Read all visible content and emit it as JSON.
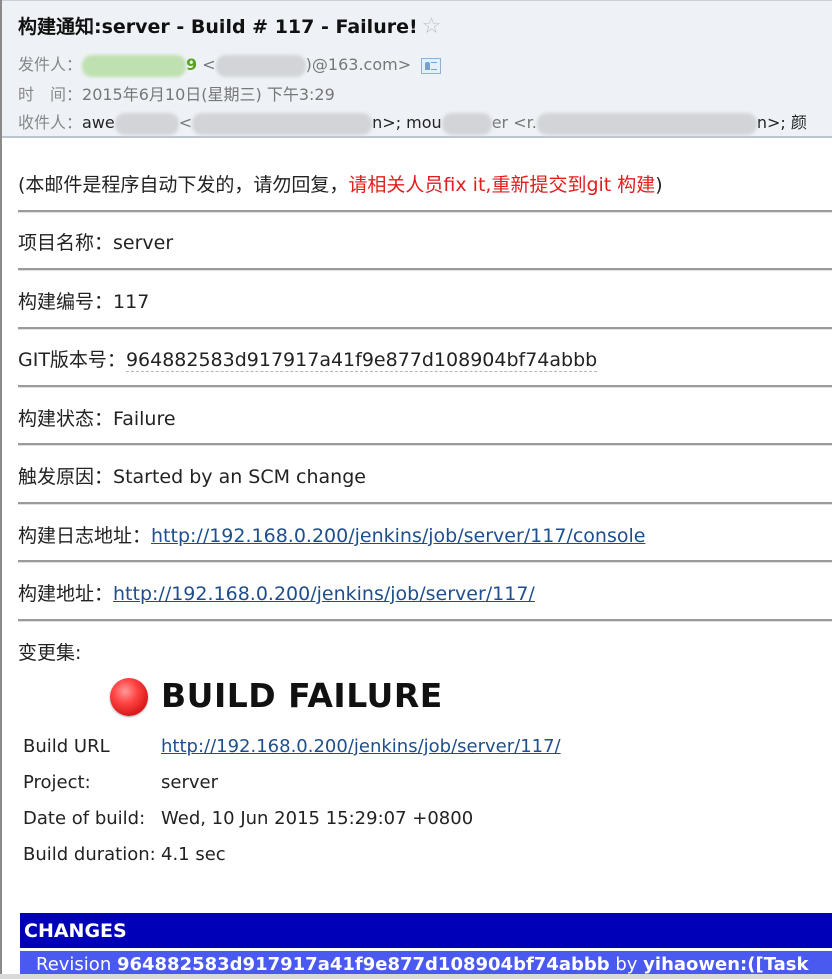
{
  "header": {
    "subject": "构建通知:server - Build # 117 - Failure!",
    "star_icon": "☆",
    "from_label": "发件人：",
    "from_name_suffix": "9",
    "from_email_open": " <",
    "from_email_suffix": ")@163.com>",
    "time_label": "时　间：",
    "time_value": "2015年6月10日(星期三) 下午3:29",
    "to_label": "收件人：",
    "to_part1": "awe",
    "to_part2": "<",
    "to_part3": "n>; mou",
    "to_part4": "er <r.",
    "to_part5": "n>; 颜"
  },
  "body": {
    "notice_prefix": "(本邮件是程序自动下发的，请勿回复，",
    "notice_red": "请相关人员fix it,重新提交到git 构建",
    "notice_suffix": ")",
    "fields": [
      {
        "label": "项目名称：",
        "value": "server"
      },
      {
        "label": "构建编号：",
        "value": "117"
      },
      {
        "label": "GIT版本号：",
        "value": "964882583d917917a41f9e877d108904bf74abbb"
      },
      {
        "label": "构建状态：",
        "value": "Failure"
      },
      {
        "label": "触发原因：",
        "value": "Started by an SCM change"
      },
      {
        "label": "构建日志地址：",
        "value": "http://192.168.0.200/jenkins/job/server/117/console"
      },
      {
        "label": "构建地址：",
        "value": "http://192.168.0.200/jenkins/job/server/117/"
      }
    ],
    "changeset_label": "变更集:"
  },
  "build_report": {
    "title": "BUILD FAILURE",
    "status_color": "#e02020",
    "rows": [
      {
        "key": "Build URL",
        "value": "http://192.168.0.200/jenkins/job/server/117/"
      },
      {
        "key": "Project:",
        "value": "server"
      },
      {
        "key": "Date of build:",
        "value": "Wed, 10 Jun 2015 15:29:07 +0800"
      },
      {
        "key": "Build duration:",
        "value": "4.1 sec"
      }
    ],
    "changes_header": "CHANGES",
    "revision_label": "Revision ",
    "revision_hash": "964882583d917917a41f9e877d108904bf74abbb",
    "revision_by": " by ",
    "revision_author": "yihaowen:([Task"
  }
}
